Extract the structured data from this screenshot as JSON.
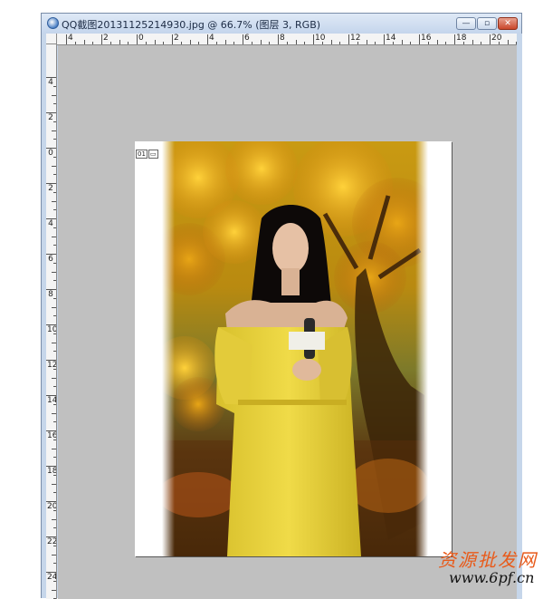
{
  "window": {
    "title": "QQ截图20131125214930.jpg @ 66.7% (图层 3, RGB)",
    "minimize_label": "—",
    "maximize_label": "▫",
    "close_label": "✕"
  },
  "ruler_top": {
    "labels": [
      "4",
      "2",
      "0",
      "2",
      "4",
      "6",
      "8",
      "10",
      "12",
      "14",
      "16",
      "18",
      "20"
    ]
  },
  "ruler_left": {
    "labels": [
      "4",
      "2",
      "0",
      "2",
      "4",
      "6",
      "8",
      "10",
      "12",
      "14",
      "16",
      "18",
      "20",
      "22",
      "24"
    ]
  },
  "document": {
    "layer_badges": [
      "01",
      "▭"
    ]
  },
  "watermark": {
    "title": "资源批发网",
    "url": "www.6pf.cn"
  },
  "colors": {
    "canvas_bg": "#c0c0c0",
    "window_chrome": "#c6d6ea",
    "dress_yellow": "#e9d33a",
    "foliage_orange": "#d88c12"
  }
}
